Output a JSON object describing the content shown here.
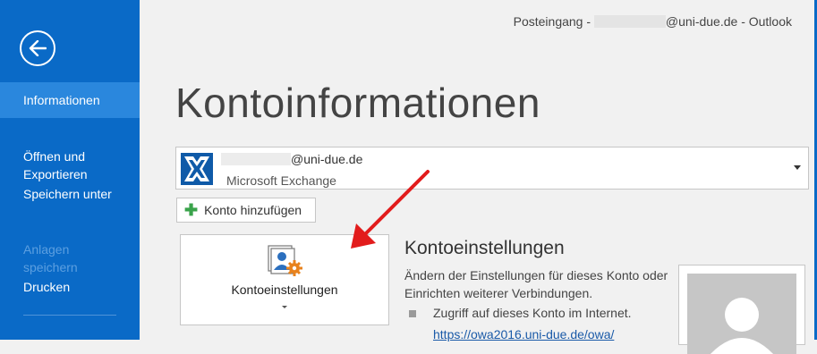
{
  "window": {
    "title_prefix": "Posteingang - ",
    "title_suffix": "@uni-due.de - Outlook"
  },
  "sidebar": {
    "back_icon": "back-arrow-icon",
    "items": [
      {
        "label": "Informationen",
        "state": "active"
      },
      {
        "label": "Öffnen und\nExportieren",
        "state": "normal"
      },
      {
        "label": "Speichern unter",
        "state": "normal"
      },
      {
        "label": "Anlagen\nspeichern",
        "state": "disabled"
      },
      {
        "label": "Drucken",
        "state": "normal"
      }
    ]
  },
  "main": {
    "page_title": "Kontoinformationen",
    "account": {
      "email_suffix": "@uni-due.de",
      "type": "Microsoft Exchange",
      "icon": "exchange-icon"
    },
    "add_account_label": "Konto hinzufügen",
    "settings_tile_label": "Kontoeinstellungen",
    "section": {
      "heading": "Kontoeinstellungen",
      "description": "Ändern der Einstellungen für dieses Konto oder Einrichten weiterer Verbindungen.",
      "bullet": "Zugriff auf dieses Konto im Internet.",
      "link": "https://owa2016.uni-due.de/owa/"
    }
  },
  "colors": {
    "sidebar": "#0a6ac7",
    "sidebar_active": "#2a87dd",
    "annotation_arrow": "#e21c1c"
  }
}
